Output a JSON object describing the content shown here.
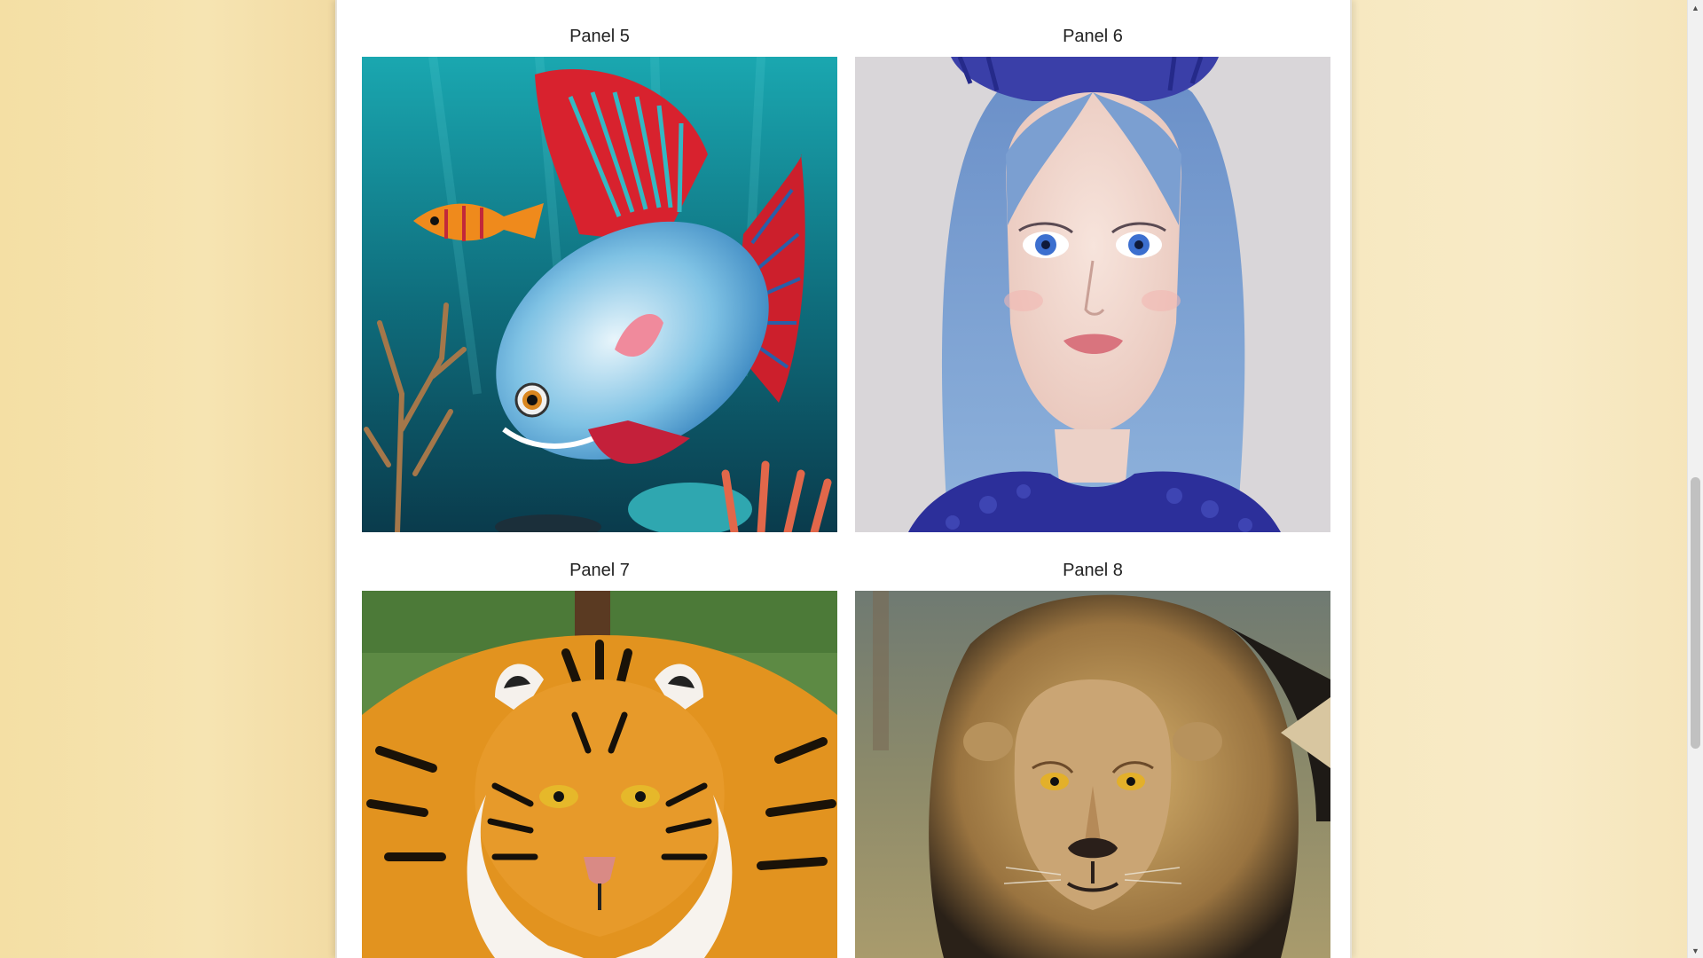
{
  "panels": [
    {
      "caption": "Panel 5",
      "icon": "fish-illustration"
    },
    {
      "caption": "Panel 6",
      "icon": "blue-haired-girl-portrait"
    },
    {
      "caption": "Panel 7",
      "icon": "tiger-portrait"
    },
    {
      "caption": "Panel 8",
      "icon": "lion-portrait"
    }
  ],
  "scrollbar": {
    "position_fraction": 0.5
  }
}
